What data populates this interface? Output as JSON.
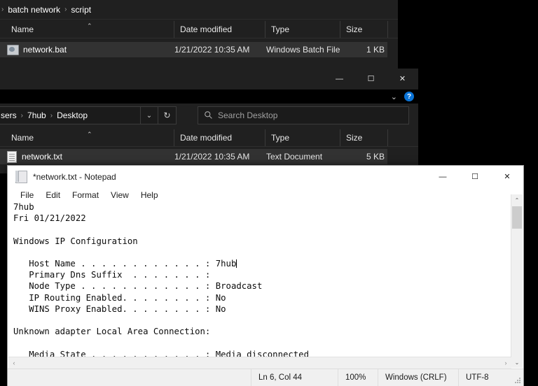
{
  "explorer_back": {
    "breadcrumb": {
      "items": [
        "batch network",
        "script"
      ],
      "separator": "›",
      "leading_separator": "›"
    },
    "columns": [
      {
        "label": "Name",
        "sorted": true,
        "sort_caret": "⌃"
      },
      {
        "label": "Date modified"
      },
      {
        "label": "Type"
      },
      {
        "label": "Size"
      }
    ],
    "rows": [
      {
        "name": "network.bat",
        "icon": "batch-file-icon",
        "date_modified": "1/21/2022 10:35 AM",
        "type": "Windows Batch File",
        "size": "1 KB"
      }
    ]
  },
  "explorer_front": {
    "window_controls": {
      "minimize": "—",
      "maximize": "☐",
      "close": "✕"
    },
    "ribbon": {
      "expand_chevron": "⌄",
      "help_label": "?"
    },
    "breadcrumb": {
      "items": [
        "sers",
        "7hub",
        "Desktop"
      ],
      "separator": "›",
      "leading_separator": "›",
      "dropdown_chevron": "⌄"
    },
    "refresh_glyph": "↻",
    "search": {
      "placeholder": "Search Desktop",
      "icon": "search-icon"
    },
    "columns": [
      {
        "label": "Name",
        "sorted": true,
        "sort_caret": "⌃"
      },
      {
        "label": "Date modified"
      },
      {
        "label": "Type"
      },
      {
        "label": "Size"
      }
    ],
    "rows": [
      {
        "name": "network.txt",
        "icon": "text-document-icon",
        "date_modified": "1/21/2022 10:35 AM",
        "type": "Text Document",
        "size": "5 KB"
      }
    ]
  },
  "notepad": {
    "title": "*network.txt - Notepad",
    "window_controls": {
      "minimize": "—",
      "maximize": "☐",
      "close": "✕"
    },
    "menu": [
      "File",
      "Edit",
      "Format",
      "View",
      "Help"
    ],
    "content": "7hub\nFri 01/21/2022\n\nWindows IP Configuration\n\n   Host Name . . . . . . . . . . . . : 7hub",
    "content_after_caret": "\n   Primary Dns Suffix  . . . . . . . :\n   Node Type . . . . . . . . . . . . : Broadcast\n   IP Routing Enabled. . . . . . . . : No\n   WINS Proxy Enabled. . . . . . . . : No\n\nUnknown adapter Local Area Connection:\n\n   Media State . . . . . . . . . . . : Media disconnected",
    "scrollbar": {
      "up_arrow": "⌃",
      "down_arrow": "⌄",
      "left_arrow": "‹",
      "right_arrow": "›"
    },
    "status": {
      "position": "Ln 6, Col 44",
      "zoom": "100%",
      "line_ending": "Windows (CRLF)",
      "encoding": "UTF-8"
    }
  },
  "colors": {
    "explorer_bg": "#202020",
    "explorer_ribbon": "#000000",
    "row_selected": "#323232",
    "accent_blue": "#0a73d6",
    "notepad_bg": "#ffffff",
    "status_bg": "#f0f0f0"
  }
}
